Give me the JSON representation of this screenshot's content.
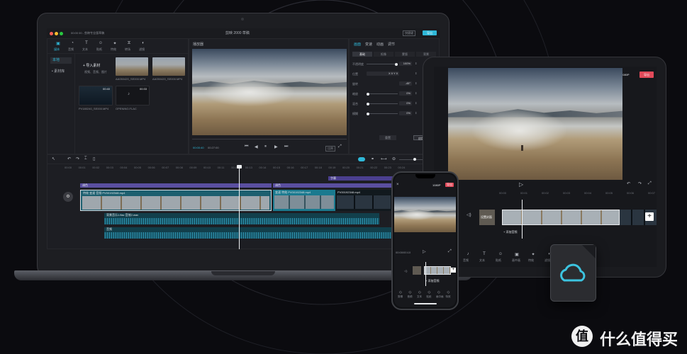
{
  "colors": {
    "accent": "#2fb8d8",
    "export_red": "#e24a5a",
    "track_purple": "#5a4fa0",
    "track_teal": "#1a7a8f",
    "audio": "#2b8aa4"
  },
  "laptop": {
    "window_title": "剪映 2000 草稿",
    "left_title": "00:00 00 - 剪映专业版草稿",
    "shortcut_label": "快捷键",
    "export_label": "导出",
    "toolbar_tabs": [
      {
        "label": "媒体",
        "icon": "media-icon"
      },
      {
        "label": "音频",
        "icon": "audio-icon"
      },
      {
        "label": "文本",
        "icon": "text-icon"
      },
      {
        "label": "贴纸",
        "icon": "sticker-icon"
      },
      {
        "label": "特效",
        "icon": "effects-icon"
      },
      {
        "label": "转场",
        "icon": "transition-icon"
      },
      {
        "label": "滤镜",
        "icon": "filter-icon"
      }
    ],
    "sidebar": [
      {
        "label": "本地"
      },
      {
        "label": "• 素材库"
      }
    ],
    "import_label": "+ 导入素材",
    "import_hint": "视频、音频、图片",
    "media": [
      {
        "name": "AA050420_SE000.MP4",
        "duration": ""
      },
      {
        "name": "AA050420_SE000.MP4",
        "duration": ""
      },
      {
        "name": "PV180240_SE000.MP4",
        "duration": "00:40"
      },
      {
        "name": "OPENING.FLAC",
        "duration": "00:33"
      }
    ],
    "player_title": "播放器",
    "time_current": "00:00:40",
    "time_total": "00:27:00",
    "ratio_label": "比例",
    "inspector_tabs": [
      "画面",
      "变速",
      "动画",
      "调节"
    ],
    "inspector_subtabs": [
      "基础",
      "抠像",
      "蒙版",
      "背景"
    ],
    "props": [
      {
        "label": "不透明度",
        "value": "100%"
      },
      {
        "label": "位置",
        "value": "X 0   Y 0"
      },
      {
        "label": "旋转",
        "value": "-45°"
      },
      {
        "label": "缩放",
        "value": "0%"
      },
      {
        "label": "混合",
        "value": "0%"
      },
      {
        "label": "模糊",
        "value": "0%"
      }
    ],
    "reset_label": "重置",
    "apply_all_label": "应用到全部",
    "ticks": [
      "00:00",
      "00:01",
      "00:02",
      "00:03",
      "00:04",
      "00:05",
      "00:06",
      "00:07",
      "00:08",
      "00:09",
      "00:10",
      "00:11",
      "00:12",
      "00:13",
      "00:14",
      "00:15",
      "00:16",
      "00:17",
      "00:18",
      "00:19",
      "00:20",
      "00:21",
      "00:22",
      "00:23",
      "00:24"
    ],
    "tracks": {
      "text_top": "字幕",
      "purple_left": "调色",
      "purple_right": "调色",
      "clip_left_meta": "特效  变速  音频  PV00192348.mp4",
      "clip_mid_meta": "变速  特效  PV00192348.mp4",
      "clip_right_meta": "PV00192348.mp4",
      "audio1": "背景音乐1.flac  音效2.wav",
      "audio2": "音频"
    }
  },
  "ipad": {
    "preview_label": "1080P",
    "export_label": "导出",
    "ticks": [
      "00:00",
      "00:01",
      "00:02",
      "00:03",
      "00:04",
      "00:05",
      "00:06",
      "00:07"
    ],
    "cover_label": "设置封面",
    "add_audio": "+ 添加音频",
    "tools": [
      {
        "label": "音频",
        "icon": "music-icon"
      },
      {
        "label": "文本",
        "icon": "text-icon"
      },
      {
        "label": "贴纸",
        "icon": "sticker-icon"
      },
      {
        "label": "画中画",
        "icon": "pip-icon"
      },
      {
        "label": "特效",
        "icon": "effects-icon"
      },
      {
        "label": "滤镜",
        "icon": "filter-icon"
      },
      {
        "label": "比例",
        "icon": "ratio-icon"
      }
    ]
  },
  "phone": {
    "preview_label": "1080P",
    "export_label": "导出",
    "time": "00:00/00:10",
    "add_audio": "+ 添加音频",
    "cover_label": "设置封面",
    "tools": [
      "剪辑",
      "音频",
      "文本",
      "贴纸",
      "画中画",
      "特效"
    ]
  },
  "watermark": {
    "badge": "值",
    "text": "什么值得买"
  }
}
